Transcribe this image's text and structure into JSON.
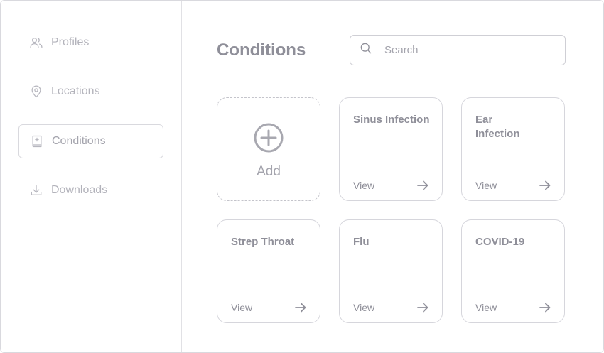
{
  "sidebar": {
    "items": [
      {
        "label": "Profiles",
        "icon": "users-icon",
        "active": false
      },
      {
        "label": "Locations",
        "icon": "map-pin-icon",
        "active": false
      },
      {
        "label": "Conditions",
        "icon": "book-plus-icon",
        "active": true
      },
      {
        "label": "Downloads",
        "icon": "download-icon",
        "active": false
      }
    ]
  },
  "main": {
    "title": "Conditions",
    "search": {
      "placeholder": "Search",
      "value": ""
    },
    "add_card": {
      "label": "Add",
      "icon": "plus-circle-icon"
    },
    "cards": [
      {
        "title": "Sinus Infection",
        "action": "View"
      },
      {
        "title": "Ear Infection",
        "action": "View"
      },
      {
        "title": "Strep Throat",
        "action": "View"
      },
      {
        "title": "Flu",
        "action": "View"
      },
      {
        "title": "COVID-19",
        "action": "View"
      }
    ]
  },
  "colors": {
    "text_muted": "#b3b3bb",
    "text": "#8f8f99",
    "border": "#d9d9de"
  }
}
